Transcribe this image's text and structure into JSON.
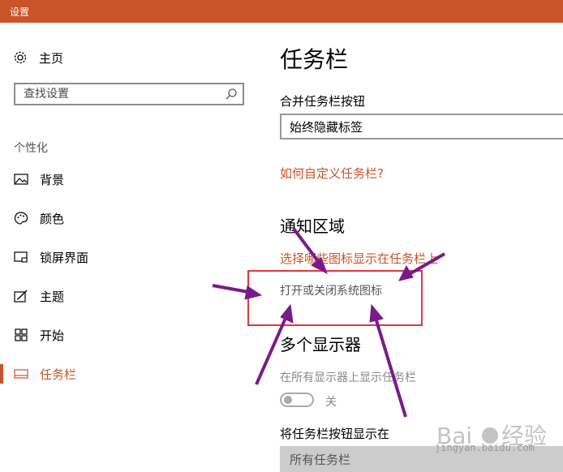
{
  "window": {
    "title": "设置"
  },
  "sidebar": {
    "home_label": "主页",
    "search_placeholder": "查找设置",
    "section_header": "个性化",
    "items": [
      {
        "label": "背景",
        "icon": "image-icon"
      },
      {
        "label": "颜色",
        "icon": "palette-icon"
      },
      {
        "label": "锁屏界面",
        "icon": "lock-screen-icon"
      },
      {
        "label": "主题",
        "icon": "theme-icon"
      },
      {
        "label": "开始",
        "icon": "start-icon"
      },
      {
        "label": "任务栏",
        "icon": "taskbar-icon",
        "active": true
      }
    ]
  },
  "main": {
    "title": "任务栏",
    "combine_label": "合并任务栏按钮",
    "combine_value": "始终隐藏标签",
    "customize_link": "如何自定义任务栏?",
    "notification_title": "通知区域",
    "select_icons_link": "选择哪些图标显示在任务栏上",
    "system_icons_link": "打开或关闭系统图标",
    "multi_display_title": "多个显示器",
    "show_all_label": "在所有显示器上显示任务栏",
    "toggle_state": "关",
    "show_buttons_label": "将任务栏按钮显示在",
    "show_buttons_value": "所有任务栏"
  },
  "colors": {
    "accent": "#c9542a",
    "highlight_box": "#e2363a",
    "arrow": "#7a1a8a"
  },
  "watermark": {
    "text": "jingyan.baidu.com"
  }
}
